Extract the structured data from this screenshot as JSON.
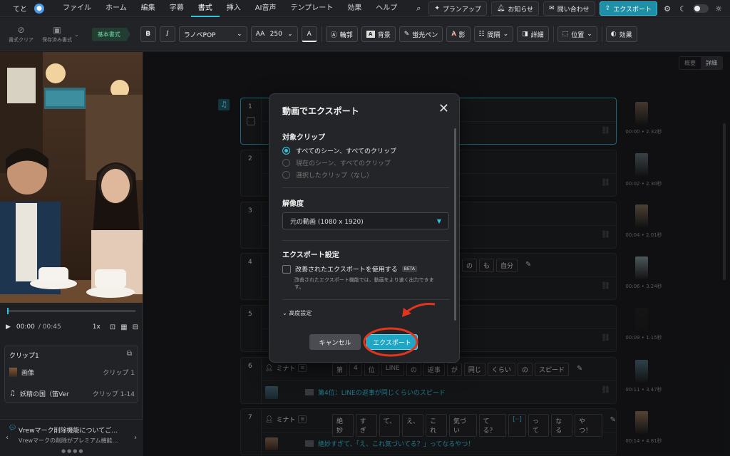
{
  "menubar": {
    "project": "てと",
    "items": [
      "ファイル",
      "ホーム",
      "編集",
      "字幕",
      "書式",
      "挿入",
      "AI音声",
      "テンプレート",
      "効果",
      "ヘルプ"
    ],
    "active_index": 4,
    "plan_up": "プランアップ",
    "notice": "お知らせ",
    "contact": "問い合わせ",
    "export": "エクスポート"
  },
  "toolbar": {
    "clear_style": "書式クリア",
    "saved_style": "保存済み書式",
    "basic_style": "基本書式",
    "bold": "B",
    "italic": "I",
    "font": "ラノベPOP",
    "size_icon": "AA",
    "size": "250",
    "color_icon": "A",
    "outline": "輪郭",
    "background": "背景",
    "highlighter": "蛍光ペン",
    "shadow": "影",
    "spacing": "間隔",
    "detail": "詳細",
    "position": "位置",
    "effect": "効果"
  },
  "player": {
    "current": "00:00",
    "total": "/ 00:45",
    "rate": "1x"
  },
  "clip_panel": {
    "title": "クリップ1",
    "rows": [
      {
        "label": "画像",
        "right": "クリップ 1"
      },
      {
        "label": "妖精の国（笛Ver",
        "right": "クリップ 1-14"
      }
    ]
  },
  "notice_bar": {
    "title": "Vrewマーク削除機能についてご…",
    "body": "Vrewマークの削除がプレミアム機能…"
  },
  "view_toggle": {
    "summary": "概要",
    "detail": "詳細"
  },
  "clips": [
    {
      "num": "1",
      "time": "00:00 • 2.32秒",
      "tone": "#6d5a4a"
    },
    {
      "num": "2",
      "time": "00:02 • 2.30秒",
      "tone": "#5c6b74"
    },
    {
      "num": "3",
      "time": "00:04 • 2.01秒",
      "tone": "#7a6a55"
    },
    {
      "num": "4",
      "time": "00:06 • 3.24秒",
      "tone": "#7c8e96"
    },
    {
      "num": "5",
      "time": "00:09 • 1.15秒",
      "tone": "#222222"
    },
    {
      "num": "6",
      "speaker": "ミナト",
      "time": "00:11 • 3.47秒",
      "tone": "#4a6a7a",
      "words": [
        "第",
        "4",
        "位",
        "LINE",
        "の",
        "返事",
        "が",
        "同じ",
        "くらい",
        "の",
        "スピード"
      ],
      "caption": "第4位：LINEの返事が同じくらいのスピード"
    },
    {
      "num": "7",
      "speaker": "ミナト",
      "time": "00:14 • 4.81秒",
      "tone": "#8a6a55",
      "words": [
        "絶妙",
        "すぎ",
        "て、",
        "え、",
        "これ",
        "気づい",
        "てる？",
        "[··]",
        "って",
        "なる",
        "やつ！"
      ],
      "caption": "絶妙すぎて、「え、これ気づいてる？」ってなるやつ！"
    }
  ],
  "clip4_words": [
    "の",
    "も",
    "自分"
  ],
  "modal": {
    "title": "動画でエクスポート",
    "target_label": "対象クリップ",
    "options": [
      "すべてのシーン、すべてのクリップ",
      "現在のシーン、すべてのクリップ",
      "選択したクリップ（なし）"
    ],
    "resolution_label": "解像度",
    "resolution_value": "元の動画 (1080 x 1920)",
    "settings_label": "エクスポート設定",
    "improved_export": "改善されたエクスポートを使用する",
    "beta": "BETA",
    "improved_note": "改善されたエクスポート機能では、動画をより速く出力できます。",
    "advanced": "高度設定",
    "cancel": "キャンセル",
    "export": "エクスポート"
  },
  "colors": {
    "accent": "#32c5e0",
    "annotation": "#e3341f"
  }
}
